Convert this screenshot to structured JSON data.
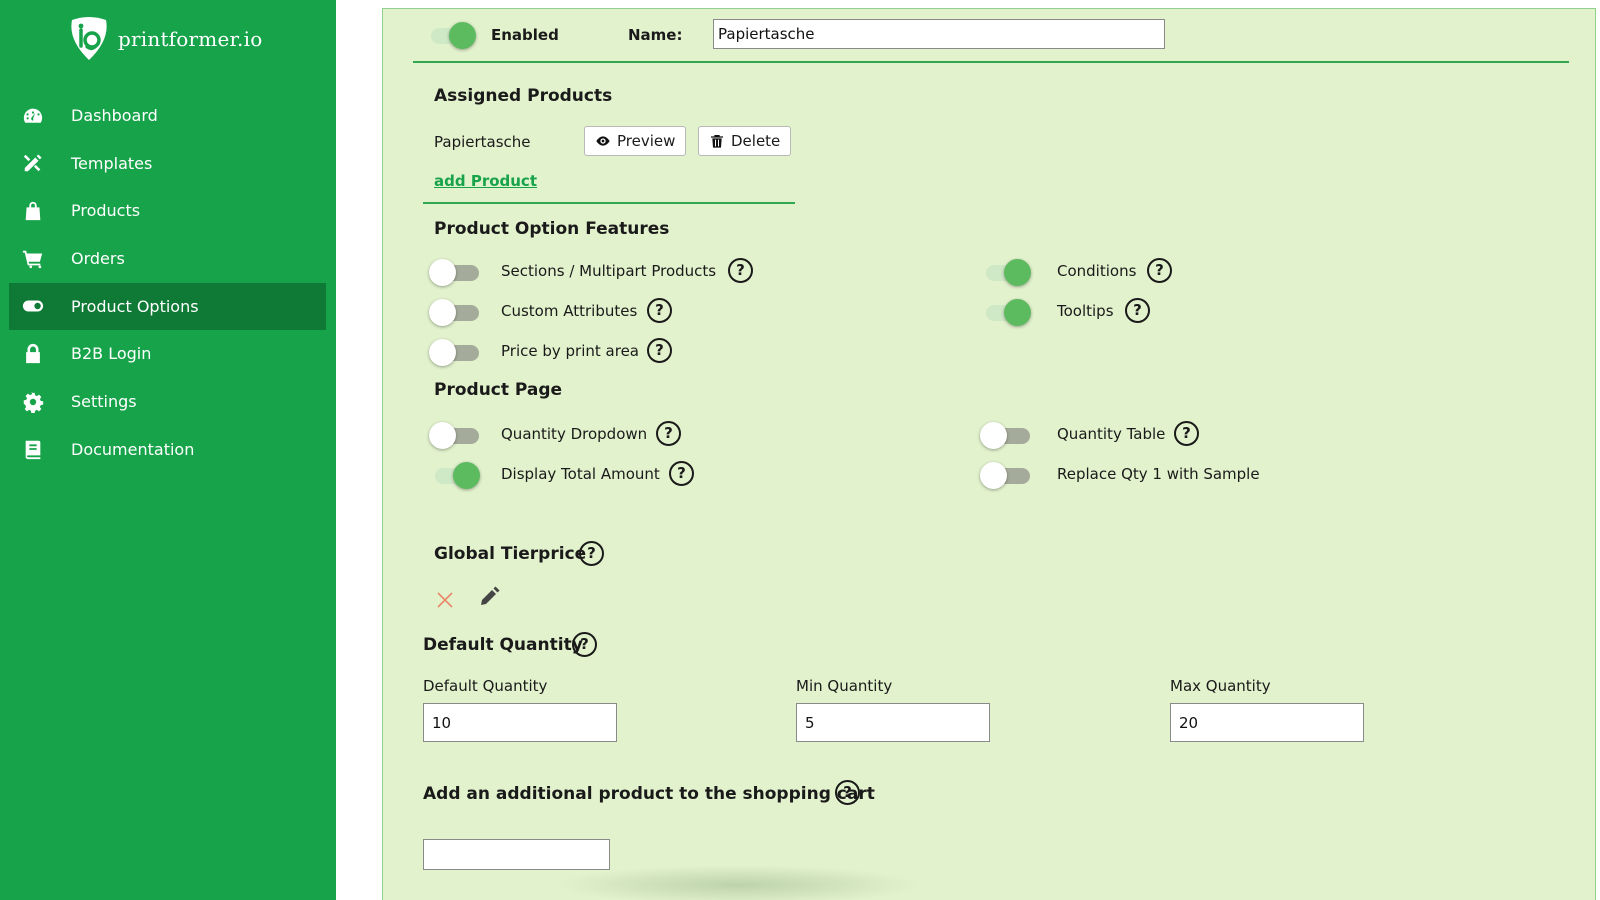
{
  "brand": {
    "name": "printformer.io"
  },
  "nav": {
    "items": [
      {
        "label": "Dashboard",
        "icon": "gauge-icon"
      },
      {
        "label": "Templates",
        "icon": "tools-icon"
      },
      {
        "label": "Products",
        "icon": "shopping-bag-icon"
      },
      {
        "label": "Orders",
        "icon": "cart-icon"
      },
      {
        "label": "Product Options",
        "icon": "toggle-icon",
        "active": true
      },
      {
        "label": "B2B Login",
        "icon": "lock-icon"
      },
      {
        "label": "Settings",
        "icon": "gear-icon"
      },
      {
        "label": "Documentation",
        "icon": "book-icon"
      }
    ]
  },
  "header": {
    "enabled_label": "Enabled",
    "enabled": true,
    "name_label": "Name:",
    "name_value": "Papiertasche"
  },
  "assigned": {
    "title": "Assigned Products",
    "product": "Papiertasche",
    "preview_label": "Preview",
    "delete_label": "Delete",
    "add_label": "add Product"
  },
  "features": {
    "title": "Product Option Features",
    "left": [
      {
        "label": "Sections / Multipart Products",
        "on": false
      },
      {
        "label": "Custom Attributes",
        "on": false
      },
      {
        "label": "Price by print area",
        "on": false
      }
    ],
    "right": [
      {
        "label": "Conditions",
        "on": true
      },
      {
        "label": "Tooltips",
        "on": true
      }
    ]
  },
  "product_page": {
    "title": "Product Page",
    "left": [
      {
        "label": "Quantity Dropdown",
        "on": false
      },
      {
        "label": "Display Total Amount",
        "on": true
      }
    ],
    "right": [
      {
        "label": "Quantity Table",
        "on": false
      },
      {
        "label": "Replace Qty 1 with Sample",
        "on": false
      }
    ]
  },
  "tierprice": {
    "title": "Global Tierprice"
  },
  "quantity": {
    "title": "Default Quantity",
    "default_label": "Default Quantity",
    "default_value": "10",
    "min_label": "Min Quantity",
    "min_value": "5",
    "max_label": "Max Quantity",
    "max_value": "20"
  },
  "cart": {
    "title": "Add an additional product to the shopping cart",
    "value": ""
  },
  "help_glyph": "?",
  "colors": {
    "sidebar": "#17a34a",
    "sidebar_active": "#0f7a35",
    "panel": "#e2f2cd",
    "accent": "#2fa84f",
    "toggle_on": "#5cbb5f",
    "delete_x": "#e88a6a"
  }
}
